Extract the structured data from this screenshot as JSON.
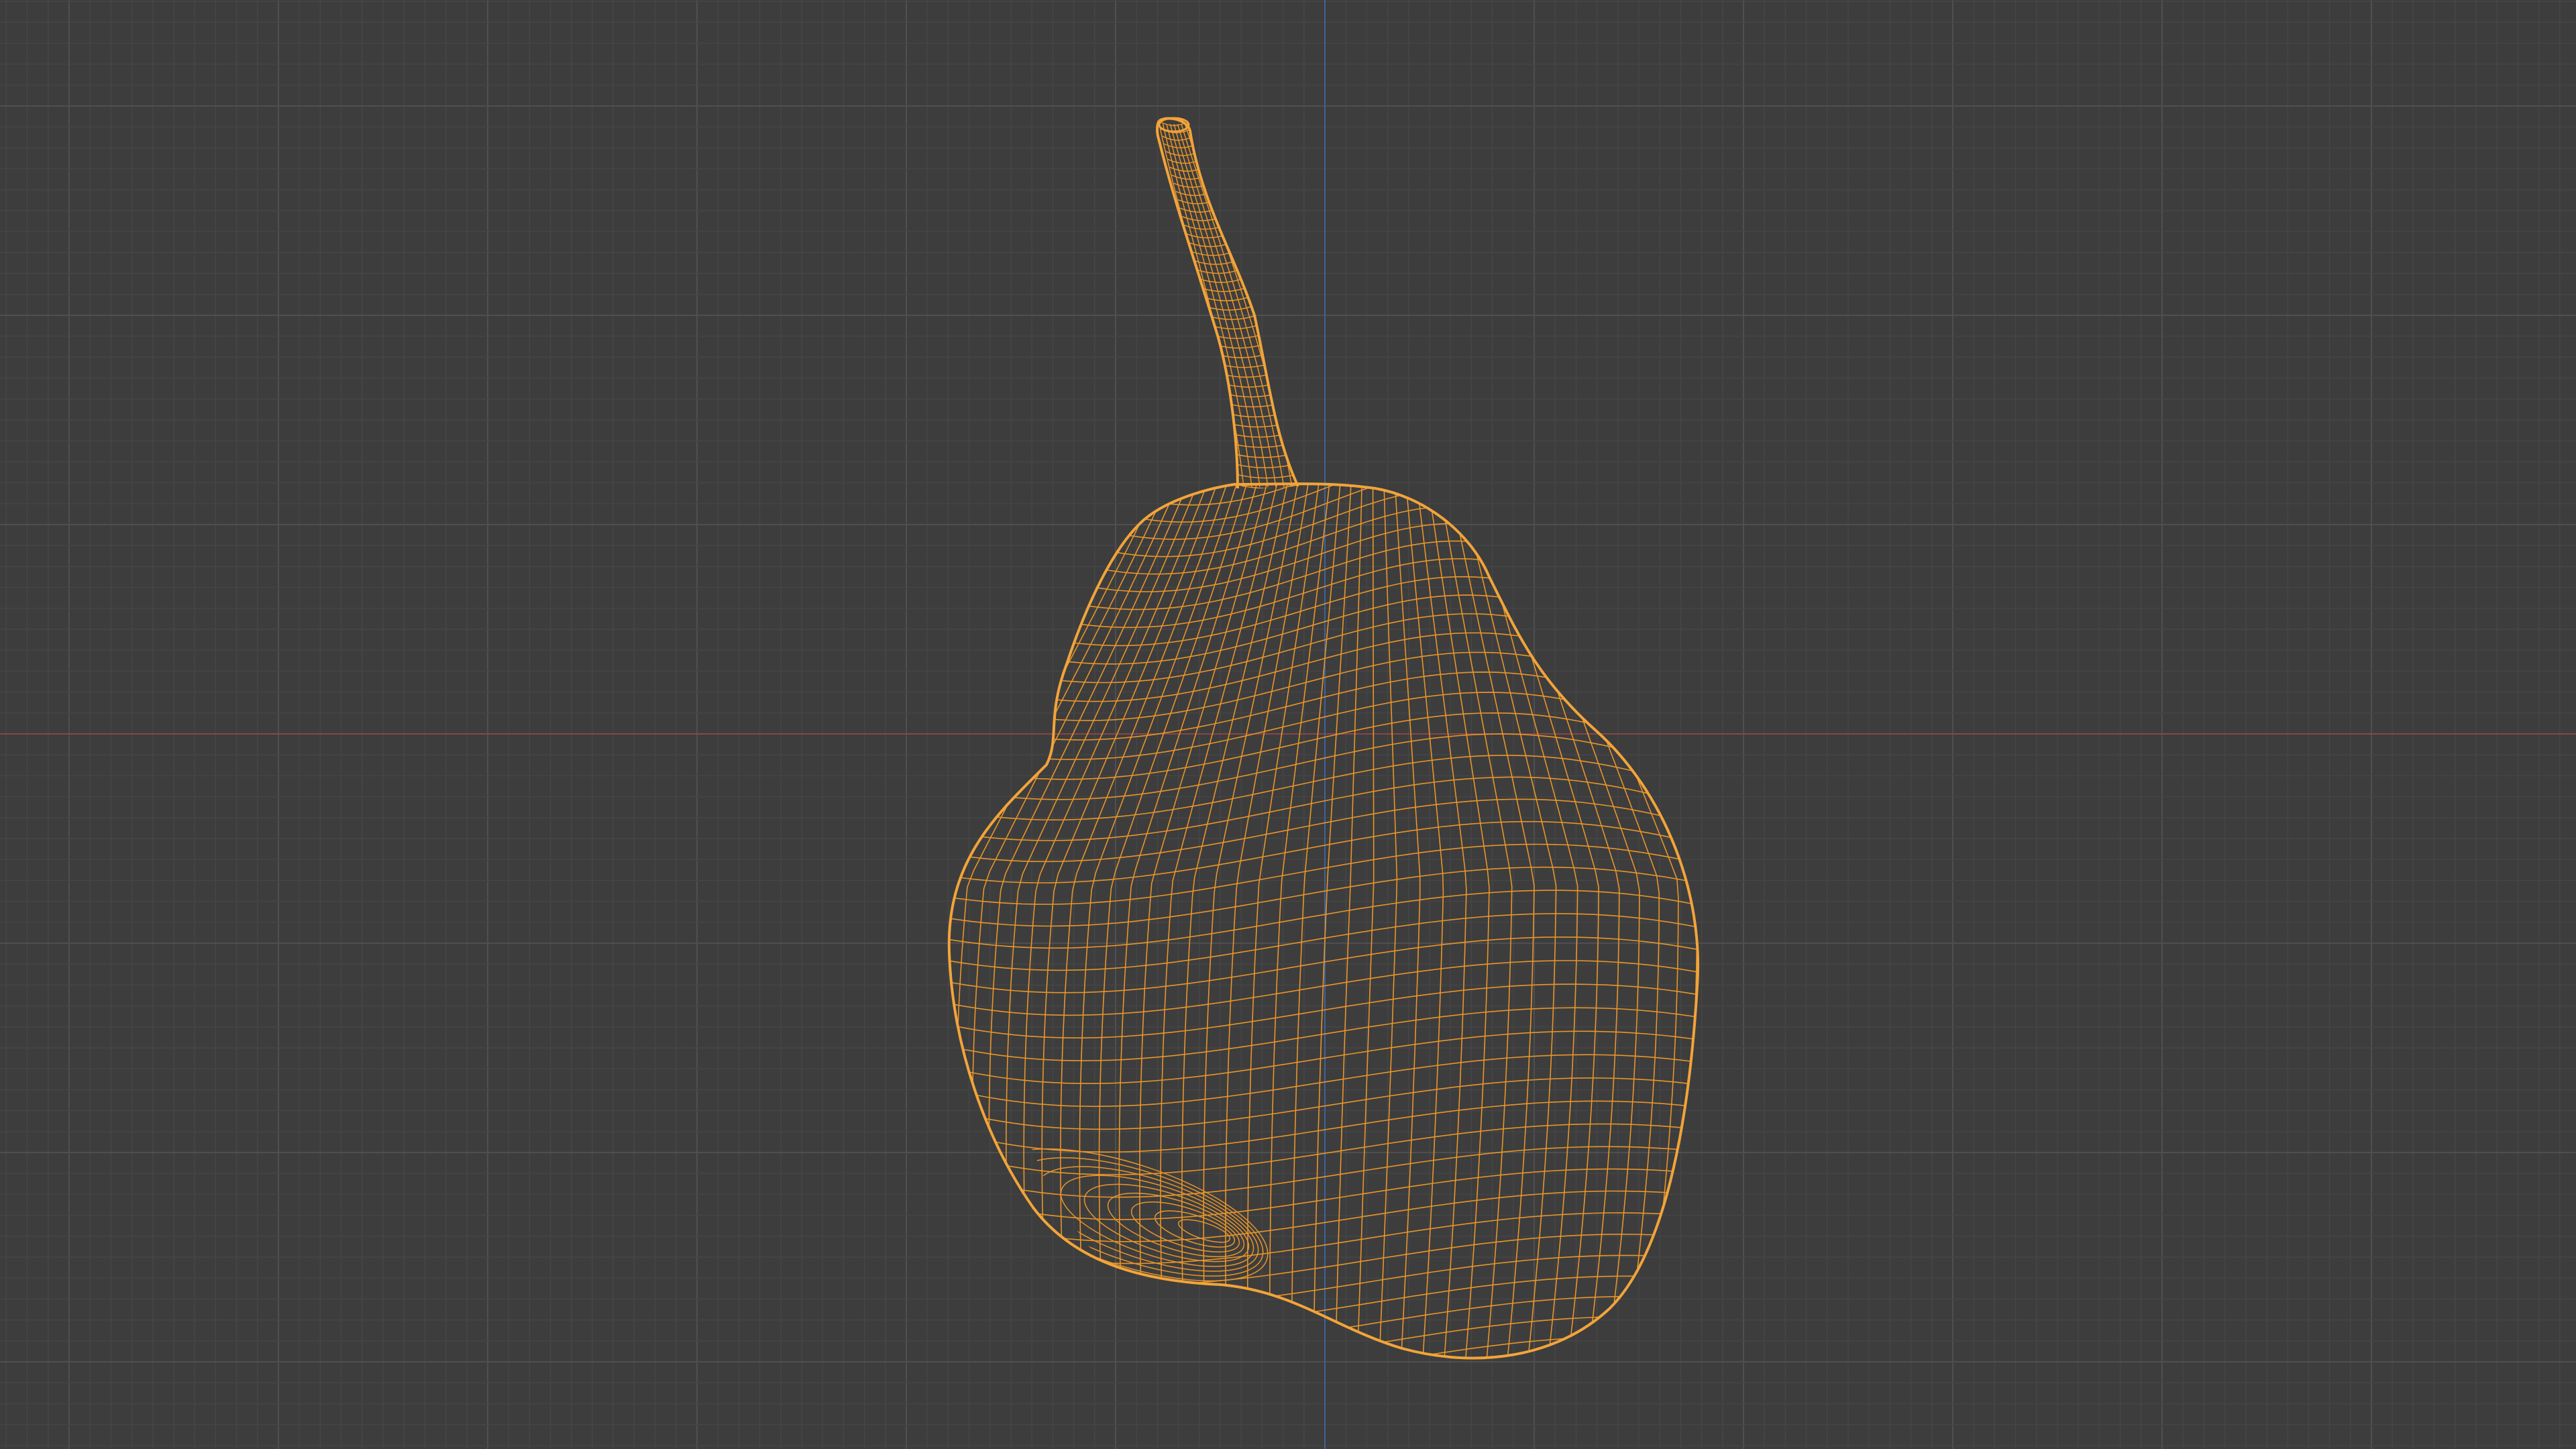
{
  "viewport": {
    "name": "3d-viewport",
    "view": "wireframe",
    "background_color": "#3d3d3d",
    "grid_minor_color": "#464646",
    "grid_major_color": "#4f4f4f",
    "x_axis_color": "#8a4545",
    "y_axis_color": "#3f6396"
  },
  "object": {
    "name": "pear",
    "kind": "wireframe-mesh",
    "selected": true,
    "wire_color": "#e8952a",
    "outline_color": "#f2a43a"
  }
}
